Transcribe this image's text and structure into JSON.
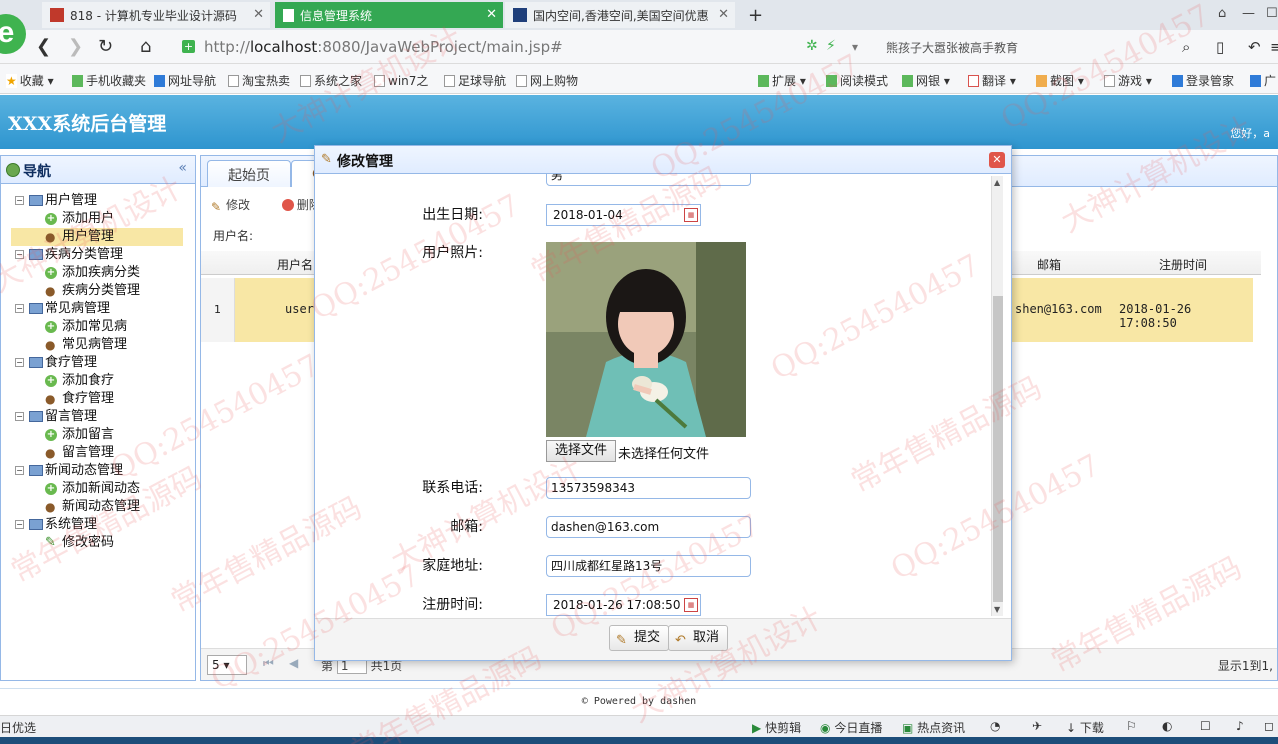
{
  "browser": {
    "tabs": [
      {
        "label": "818 - 计算机专业毕业设计源码"
      },
      {
        "label": "信息管理系统"
      },
      {
        "label": "国内空间,香港空间,美国空间优惠"
      }
    ],
    "url_prefix": "http://",
    "url_host": "localhost",
    "url_path": ":8080/JavaWebProject/main.jsp#",
    "search_text": "熊孩子大嚣张被高手教育"
  },
  "bookmarks": {
    "left": [
      "收藏",
      "手机收藏夹",
      "网址导航",
      "淘宝热卖",
      "系统之家",
      "win7之",
      "足球导航",
      "网上购物"
    ],
    "right": [
      "扩展",
      "阅读模式",
      "网银",
      "翻译",
      "截图",
      "游戏",
      "登录管家",
      "广"
    ]
  },
  "app": {
    "title": "XXX系统后台管理",
    "welcome": "您好，a"
  },
  "nav": {
    "title": "导航",
    "groups": [
      {
        "label": "用户管理",
        "items": [
          "添加用户",
          "用户管理"
        ]
      },
      {
        "label": "疾病分类管理",
        "items": [
          "添加疾病分类",
          "疾病分类管理"
        ]
      },
      {
        "label": "常见病管理",
        "items": [
          "添加常见病",
          "常见病管理"
        ]
      },
      {
        "label": "食疗管理",
        "items": [
          "添加食疗",
          "食疗管理"
        ]
      },
      {
        "label": "留言管理",
        "items": [
          "添加留言",
          "留言管理"
        ]
      },
      {
        "label": "新闻动态管理",
        "items": [
          "添加新闻动态",
          "新闻动态管理"
        ]
      },
      {
        "label": "系统管理",
        "items": [
          "修改密码"
        ]
      }
    ]
  },
  "main": {
    "tab_home": "起始页",
    "toolbar_edit": "修改",
    "toolbar_delete": "删除",
    "search_label": "用户名:",
    "col_username": "用户名",
    "col_email": "邮箱",
    "col_regtime": "注册时间",
    "row_num": "1",
    "row_user": "user",
    "row_email": "shen@163.com",
    "row_regtime": "2018-01-26 17:08:50",
    "page_size": "5",
    "page_info_prefix": "第",
    "page_info_num": "1",
    "page_info_total": "共1页",
    "display_info": "显示1到1,"
  },
  "modal": {
    "title": "修改管理",
    "partial_field_value": "男",
    "birth_label": "出生日期:",
    "birth_value": "2018-01-04",
    "photo_label": "用户照片:",
    "file_button": "选择文件",
    "file_status": "未选择任何文件",
    "phone_label": "联系电话:",
    "phone_value": "13573598343",
    "email_label": "邮箱:",
    "email_value": "dashen@163.com",
    "address_label": "家庭地址:",
    "address_value": "四川成都红星路13号",
    "regtime_label": "注册时间:",
    "regtime_value": "2018-01-26 17:08:50",
    "submit_label": "提交",
    "cancel_label": "取消"
  },
  "footer": {
    "text": "© Powered by dashen"
  },
  "statusbar": {
    "left": "日优选",
    "items": [
      "快剪辑",
      "今日直播",
      "热点资讯",
      "下载"
    ]
  },
  "watermarks": [
    "QQ:254540457",
    "大神计算机设计",
    "常年售精品源码"
  ],
  "colors": {
    "header": "#3ea3d8",
    "selected_row": "#f8e7a5",
    "active_tab": "#34a853",
    "border": "#95b8e7"
  }
}
